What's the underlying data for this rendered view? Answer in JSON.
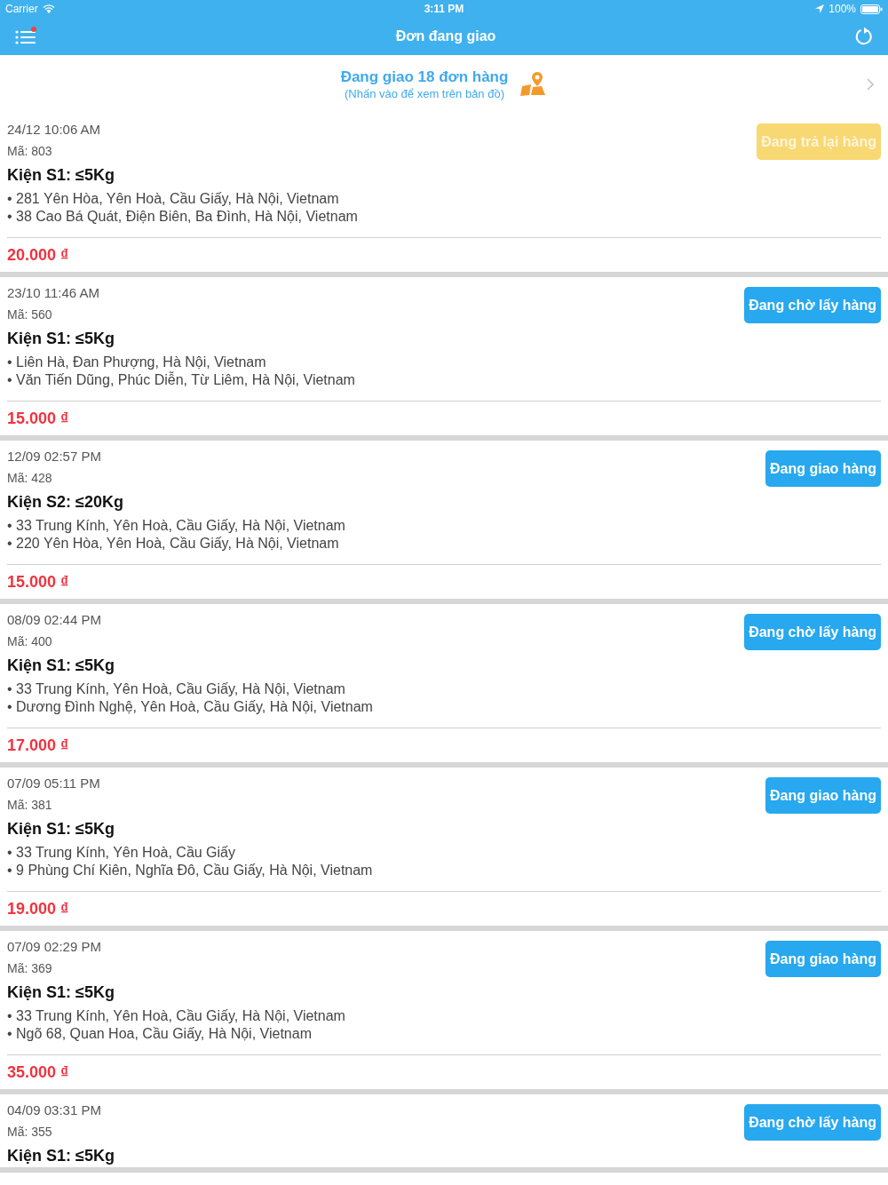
{
  "status_bar": {
    "carrier": "Carrier",
    "time": "3:11 PM",
    "battery": "100%"
  },
  "nav": {
    "title": "Đơn đang giao",
    "menu_badge": true
  },
  "summary": {
    "title": "Đang giao 18 đơn hàng",
    "subtitle": "(Nhấn vào để xem trên bản đồ)"
  },
  "orders": [
    {
      "date": "24/12 10:06 AM",
      "code": "Mã: 803",
      "package": "Kiện S1: ≤5Kg",
      "addresses": [
        "• 281 Yên Hòa, Yên Hoà, Cầu Giấy, Hà Nội, Vietnam",
        "• 38 Cao Bá Quát, Điện Biên, Ba Đình, Hà Nội, Vietnam"
      ],
      "price": "20.000 ₫",
      "status": {
        "label": "Đang trả lại hàng",
        "kind": "returning"
      }
    },
    {
      "date": "23/10 11:46 AM",
      "code": "Mã: 560",
      "package": "Kiện S1: ≤5Kg",
      "addresses": [
        "• Liên Hà, Đan Phượng, Hà Nội, Vietnam",
        "• Văn Tiến Dũng, Phúc Diễn, Từ Liêm, Hà Nội, Vietnam"
      ],
      "price": "15.000 ₫",
      "status": {
        "label": "Đang chờ lấy hàng",
        "kind": "waiting"
      }
    },
    {
      "date": "12/09 02:57 PM",
      "code": "Mã: 428",
      "package": "Kiện S2: ≤20Kg",
      "addresses": [
        "• 33 Trung Kính, Yên Hoà, Cầu Giấy, Hà Nội, Vietnam",
        "• 220 Yên Hòa, Yên Hoà, Cầu Giấy, Hà Nội, Vietnam"
      ],
      "price": "15.000 ₫",
      "status": {
        "label": "Đang giao hàng",
        "kind": "delivering"
      }
    },
    {
      "date": "08/09 02:44 PM",
      "code": "Mã: 400",
      "package": "Kiện S1: ≤5Kg",
      "addresses": [
        "• 33 Trung Kính, Yên Hoà, Cầu Giấy, Hà Nội, Vietnam",
        "• Dương Đình Nghệ, Yên Hoà, Cầu Giấy, Hà Nội, Vietnam"
      ],
      "price": "17.000 ₫",
      "status": {
        "label": "Đang chờ lấy hàng",
        "kind": "waiting"
      }
    },
    {
      "date": "07/09 05:11 PM",
      "code": "Mã: 381",
      "package": "Kiện S1: ≤5Kg",
      "addresses": [
        "• 33 Trung Kính, Yên Hoà, Cầu Giấy",
        "• 9 Phùng Chí Kiên, Nghĩa Đô, Cầu Giấy, Hà Nội, Vietnam"
      ],
      "price": "19.000 ₫",
      "status": {
        "label": "Đang giao hàng",
        "kind": "delivering"
      }
    },
    {
      "date": "07/09 02:29 PM",
      "code": "Mã: 369",
      "package": "Kiện S1: ≤5Kg",
      "addresses": [
        "• 33 Trung Kính, Yên Hoà, Cầu Giấy, Hà Nội, Vietnam",
        "• Ngõ 68, Quan Hoa, Cầu Giấy, Hà Nội, Vietnam"
      ],
      "price": "35.000 ₫",
      "status": {
        "label": "Đang giao hàng",
        "kind": "delivering"
      }
    },
    {
      "date": "04/09 03:31 PM",
      "code": "Mã: 355",
      "package": "Kiện S1: ≤5Kg",
      "status": {
        "label": "Đang chờ lấy hàng",
        "kind": "waiting"
      }
    }
  ]
}
